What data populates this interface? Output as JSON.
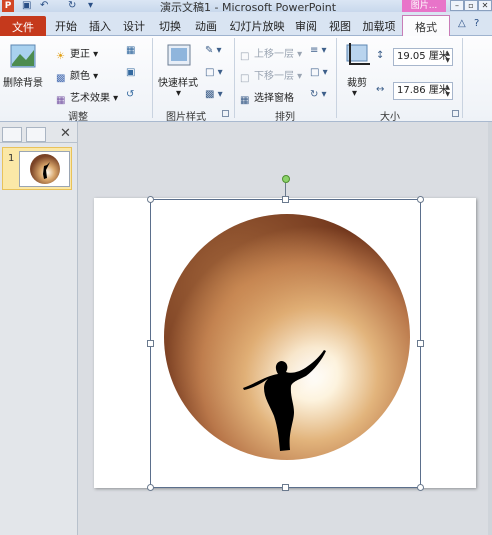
{
  "titlebar": {
    "logo": "P",
    "title": "演示文稿1 - Microsoft PowerPoint",
    "context_tab_head": "图片...",
    "win_buttons": [
      "–",
      "▫",
      "✕"
    ]
  },
  "tabs": [
    {
      "label": "文件"
    },
    {
      "label": "开始"
    },
    {
      "label": "插入"
    },
    {
      "label": "设计"
    },
    {
      "label": "切换"
    },
    {
      "label": "动画"
    },
    {
      "label": "幻灯片放映"
    },
    {
      "label": "审阅"
    },
    {
      "label": "视图"
    },
    {
      "label": "加载项"
    },
    {
      "label": "格式"
    }
  ],
  "ribbon": {
    "adjust": {
      "remove_bg": "删除背景",
      "corrections": "更正",
      "color": "颜色",
      "artistic": "艺术效果",
      "group_label": "调整"
    },
    "styles": {
      "quick_styles": "快速样式",
      "group_label": "图片样式"
    },
    "arrange": {
      "bring_forward": "上移一层",
      "send_backward": "下移一层",
      "selection_pane": "选择窗格",
      "group_label": "排列"
    },
    "size": {
      "crop": "裁剪",
      "height": "19.05 厘米",
      "width": "17.86 厘米",
      "group_label": "大小"
    }
  },
  "pane": {
    "slide_number": "1",
    "close": "✕"
  },
  "colors": {
    "file_tab": "#c5391c",
    "context_tab": "#e874c9",
    "rotate_handle": "#8cd36a"
  }
}
